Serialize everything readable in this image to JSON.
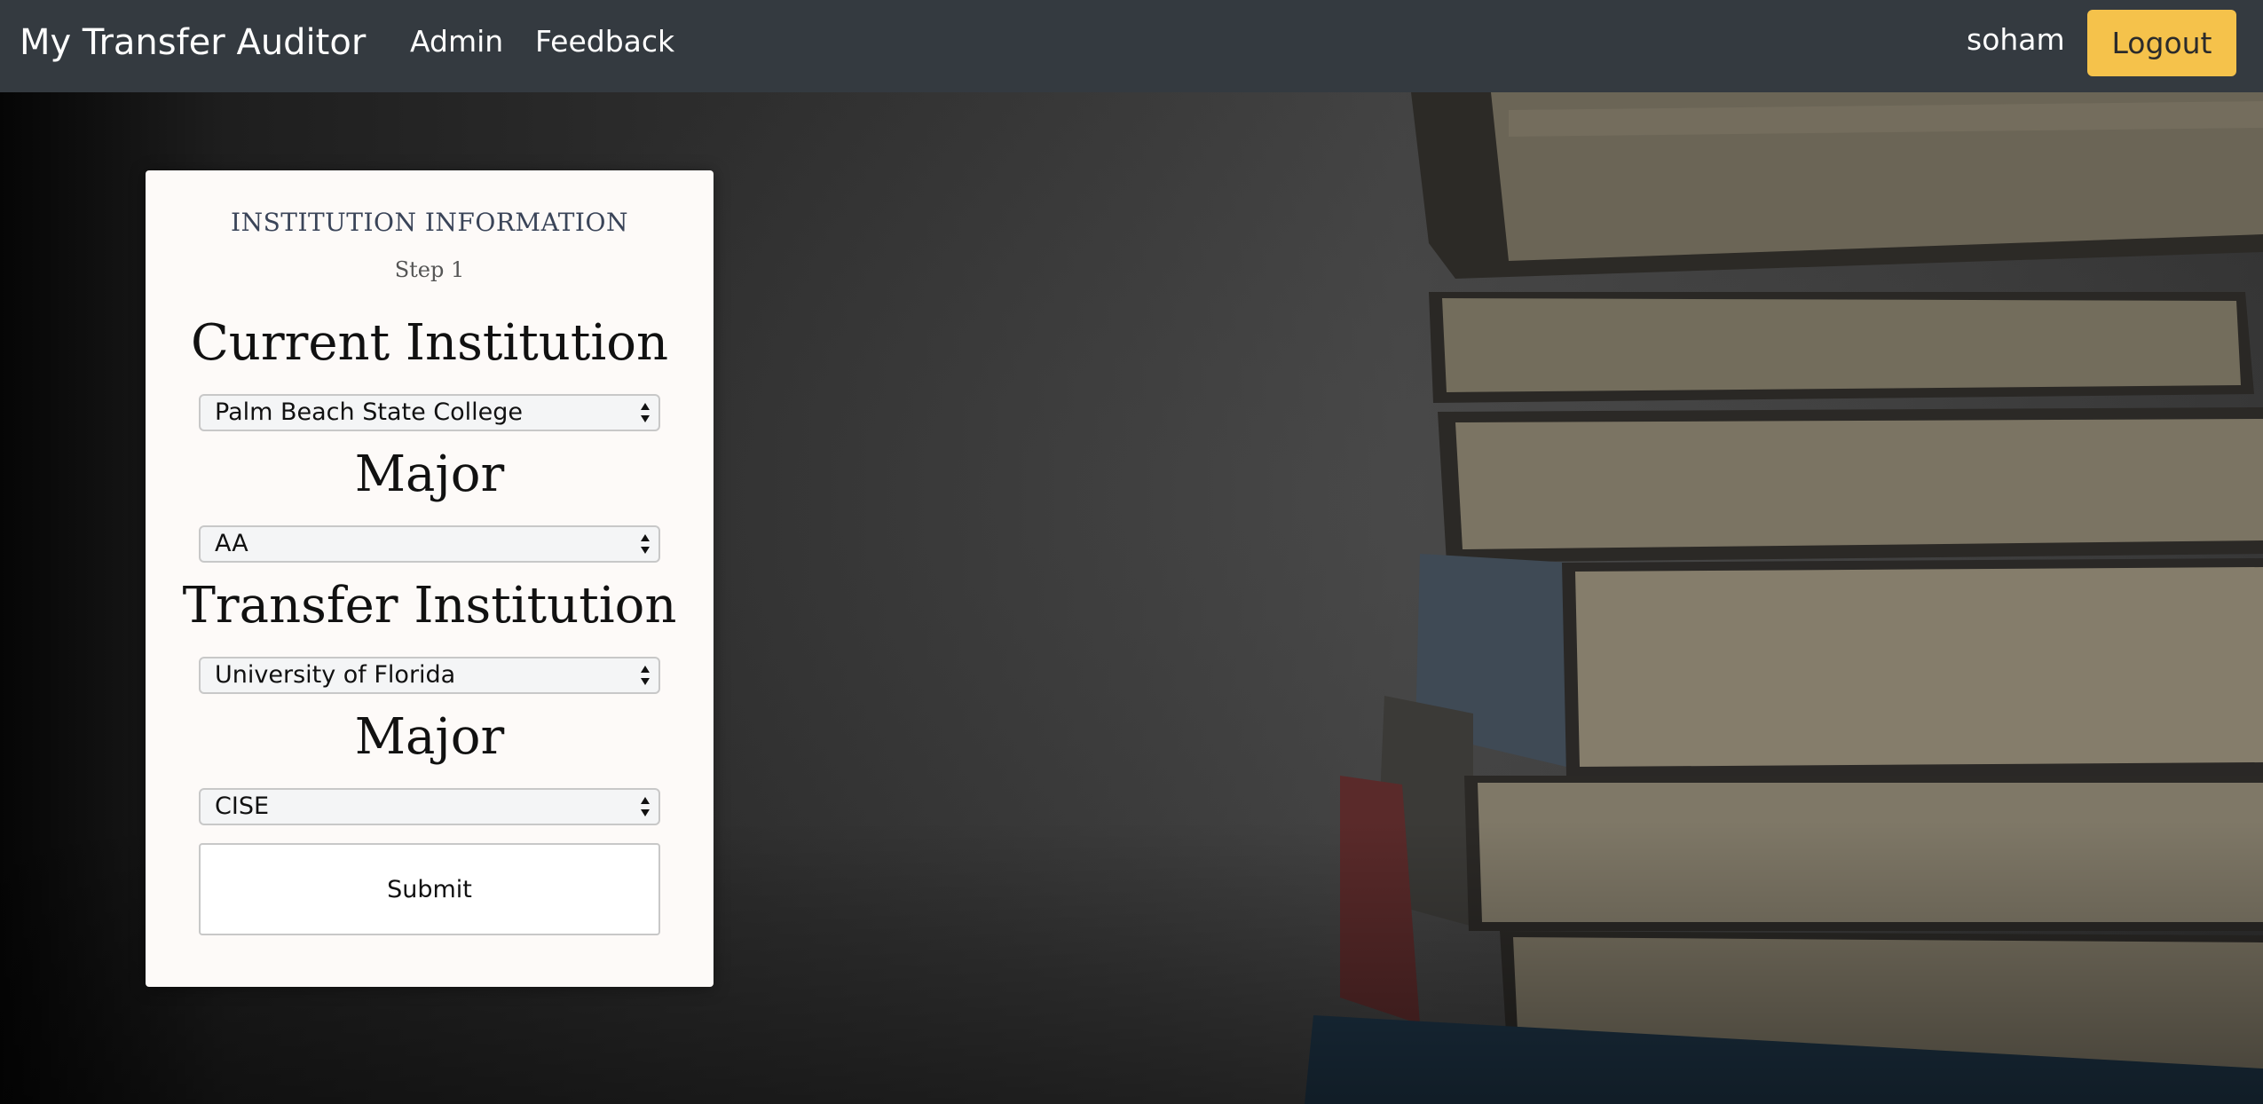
{
  "navbar": {
    "brand": "My Transfer Auditor",
    "links": [
      "Admin",
      "Feedback"
    ],
    "username": "soham",
    "logout_label": "Logout",
    "background": "#343a40",
    "logout_color": "#f5c24b"
  },
  "card": {
    "title": "INSTITUTION INFORMATION",
    "step": "Step 1",
    "fields": [
      {
        "label": "Current Institution",
        "selected": "Palm Beach State College"
      },
      {
        "label": "Major",
        "selected": "AA"
      },
      {
        "label": "Transfer Institution",
        "selected": "University of Florida"
      },
      {
        "label": "Major",
        "selected": "CISE"
      }
    ],
    "submit_label": "Submit"
  },
  "icons": {
    "select_arrow": "up-down-caret-icon"
  }
}
